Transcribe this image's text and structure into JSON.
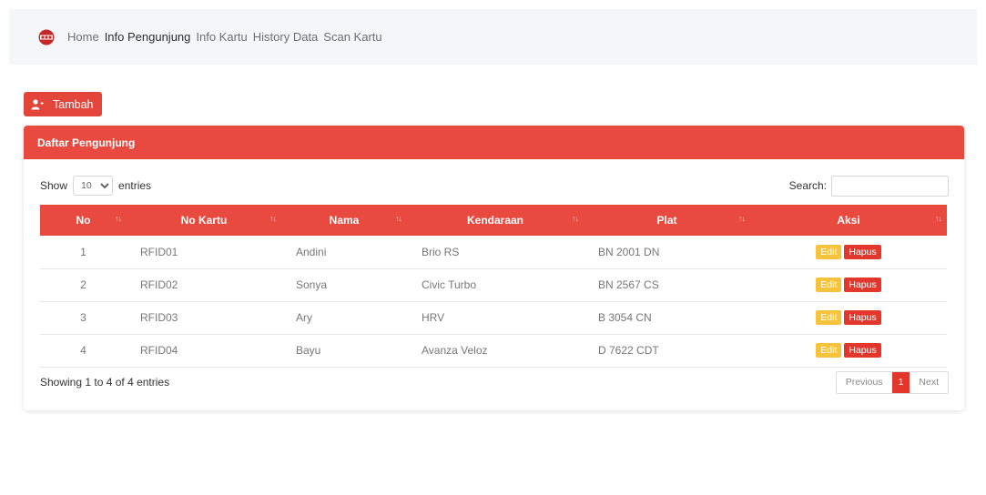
{
  "nav": {
    "items": [
      "Home",
      "Info Pengunjung",
      "Info Kartu",
      "History Data",
      "Scan Kartu"
    ],
    "active_index": 1
  },
  "actions": {
    "add_label": "Tambah"
  },
  "card": {
    "title": "Daftar Pengunjung"
  },
  "table_controls": {
    "show_label": "Show",
    "page_length": "10",
    "entries_label": "entries",
    "search_label": "Search:",
    "search_value": ""
  },
  "table": {
    "columns": [
      "No",
      "No Kartu",
      "Nama",
      "Kendaraan",
      "Plat",
      "Aksi"
    ],
    "rows": [
      {
        "no": "1",
        "kartu": "RFID01",
        "nama": "Andini",
        "kendaraan": "Brio RS",
        "plat": "BN 2001 DN"
      },
      {
        "no": "2",
        "kartu": "RFID02",
        "nama": "Sonya",
        "kendaraan": "Civic Turbo",
        "plat": "BN 2567 CS"
      },
      {
        "no": "3",
        "kartu": "RFID03",
        "nama": "Ary",
        "kendaraan": "HRV",
        "plat": "B 3054 CN"
      },
      {
        "no": "4",
        "kartu": "RFID04",
        "nama": "Bayu",
        "kendaraan": "Avanza Veloz",
        "plat": "D 7622 CDT"
      }
    ],
    "edit_label": "Edit",
    "delete_label": "Hapus"
  },
  "footer": {
    "info": "Showing 1 to 4 of 4 entries",
    "previous": "Previous",
    "current_page": "1",
    "next": "Next"
  },
  "colors": {
    "primary": "#e84a3f",
    "edit": "#f6c33b",
    "delete": "#e3372e",
    "navbar_bg": "#f5f6fa"
  },
  "icons": {
    "logo": "logo-icon",
    "add_user": "user-plus-icon",
    "sort": "sort-icon"
  }
}
